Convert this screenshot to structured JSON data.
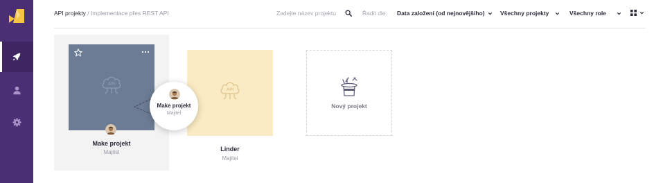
{
  "sidebar": {
    "logo": "lightning-logo",
    "items": [
      {
        "name": "projects",
        "icon": "rocket-icon",
        "active": true
      },
      {
        "name": "users",
        "icon": "user-icon",
        "active": false
      },
      {
        "name": "settings",
        "icon": "gear-icon",
        "active": false
      }
    ]
  },
  "header": {
    "breadcrumb": {
      "main": "API projekty",
      "separator": " / ",
      "sub": "Implementace přes REST API"
    },
    "search": {
      "placeholder": "Zadejte název projektu",
      "value": ""
    },
    "sort_label": "Řadit dle:",
    "sort_value": "Data založení (od nejnovějšího)",
    "filter_projects": "Všechny projekty",
    "filter_roles": "Všechny role"
  },
  "projects": [
    {
      "name": "Make projekt",
      "role": "Majitel",
      "tile_color": "#6b7c94",
      "selected": true
    },
    {
      "name": "Linder",
      "role": "Majitel",
      "tile_color": "#fbebc4",
      "selected": false
    }
  ],
  "popup": {
    "name": "Make projekt",
    "role": "Majitel"
  },
  "new_project": {
    "label": "Nový projekt",
    "icon": "magic-hat-icon"
  },
  "colors": {
    "sidebar": "#4a2f74",
    "accent": "#f6c343"
  }
}
